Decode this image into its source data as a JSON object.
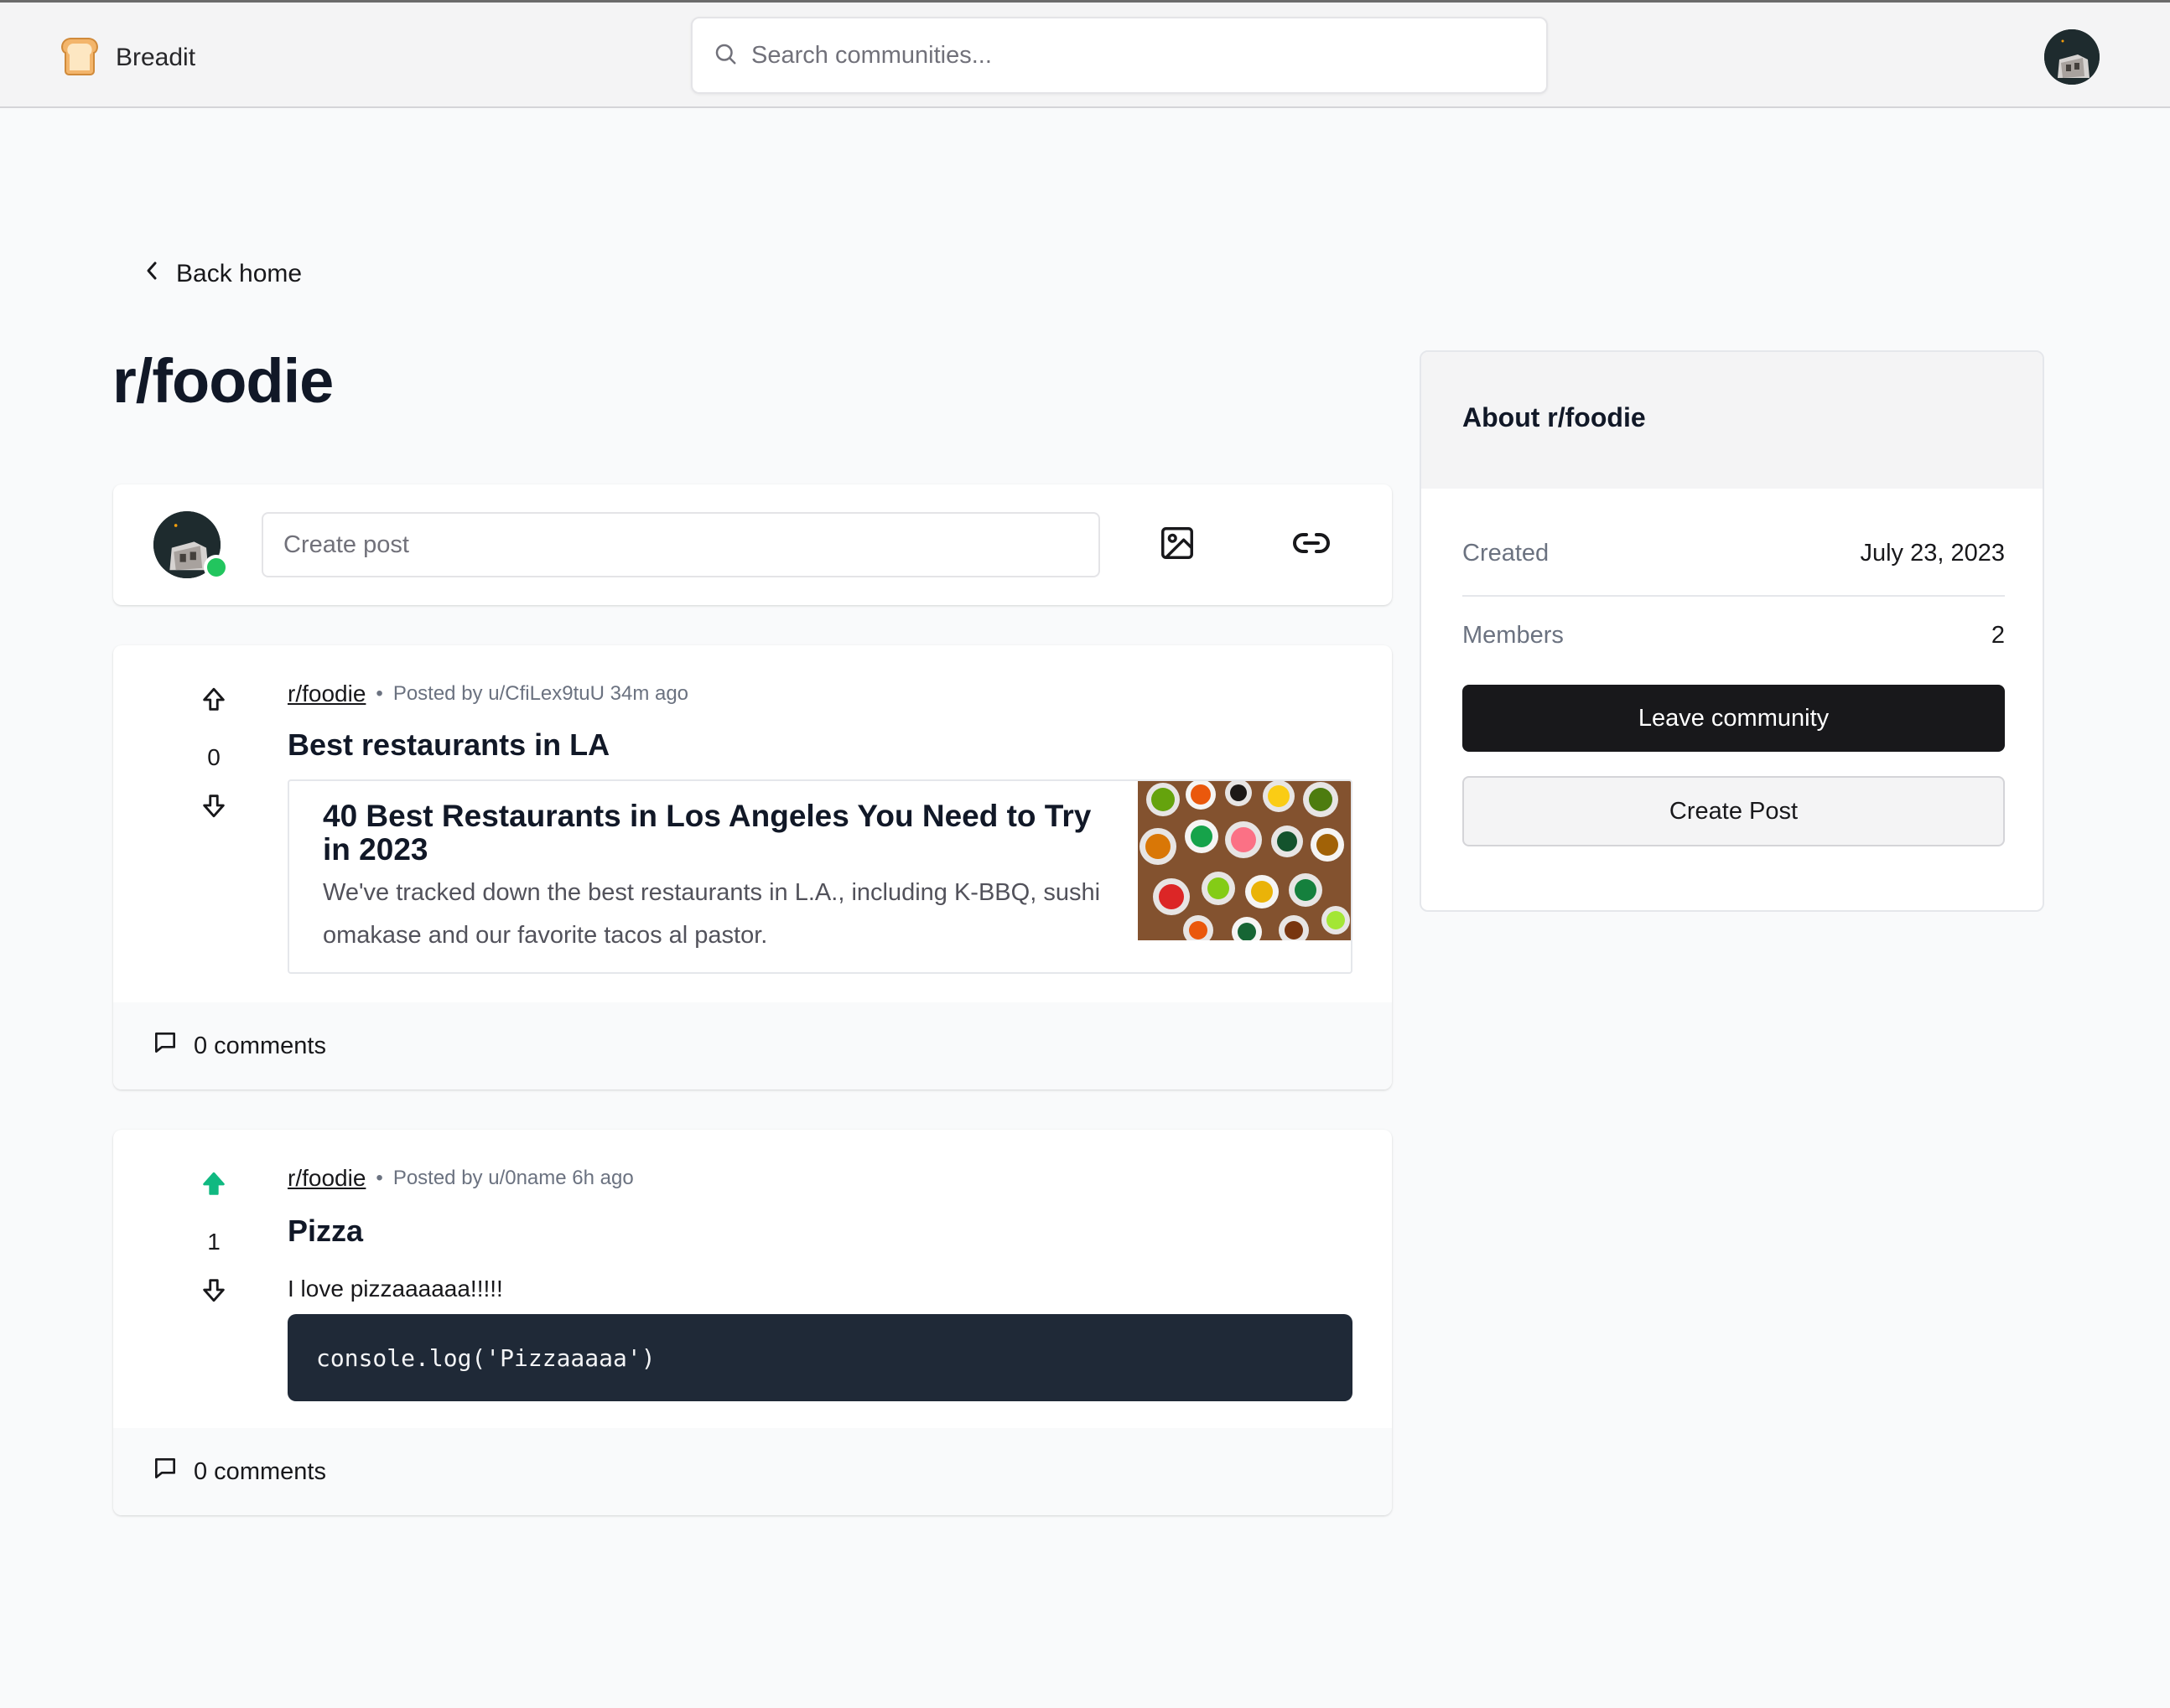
{
  "app": {
    "name": "Breadit"
  },
  "search": {
    "placeholder": "Search communities..."
  },
  "nav": {
    "back_label": "Back home"
  },
  "community": {
    "title": "r/foodie"
  },
  "create_post": {
    "placeholder": "Create post"
  },
  "posts": [
    {
      "subreddit": "r/foodie",
      "meta": "Posted by u/CfiLex9tuU 34m ago",
      "votes": "0",
      "upvoted": false,
      "title": "Best restaurants in LA",
      "link": {
        "title": "40 Best Restaurants in Los Angeles You Need to Try in 2023",
        "description": "We've tracked down the best restaurants in L.A., including K-BBQ, sushi omakase and our favorite tacos al pastor."
      },
      "comments": "0 comments"
    },
    {
      "subreddit": "r/foodie",
      "meta": "Posted by u/0name 6h ago",
      "votes": "1",
      "upvoted": true,
      "title": "Pizza",
      "text": "I love pizzaaaaaa!!!!!",
      "code": "console.log('Pizzaaaaa')",
      "comments": "0 comments"
    }
  ],
  "about": {
    "title": "About r/foodie",
    "created_label": "Created",
    "created_value": "July 23, 2023",
    "members_label": "Members",
    "members_value": "2",
    "leave_label": "Leave community",
    "create_label": "Create Post"
  },
  "colors": {
    "accent_upvote": "#10b981",
    "online": "#22c55e",
    "dark_button": "#18181b",
    "code_bg": "#1f2937"
  }
}
